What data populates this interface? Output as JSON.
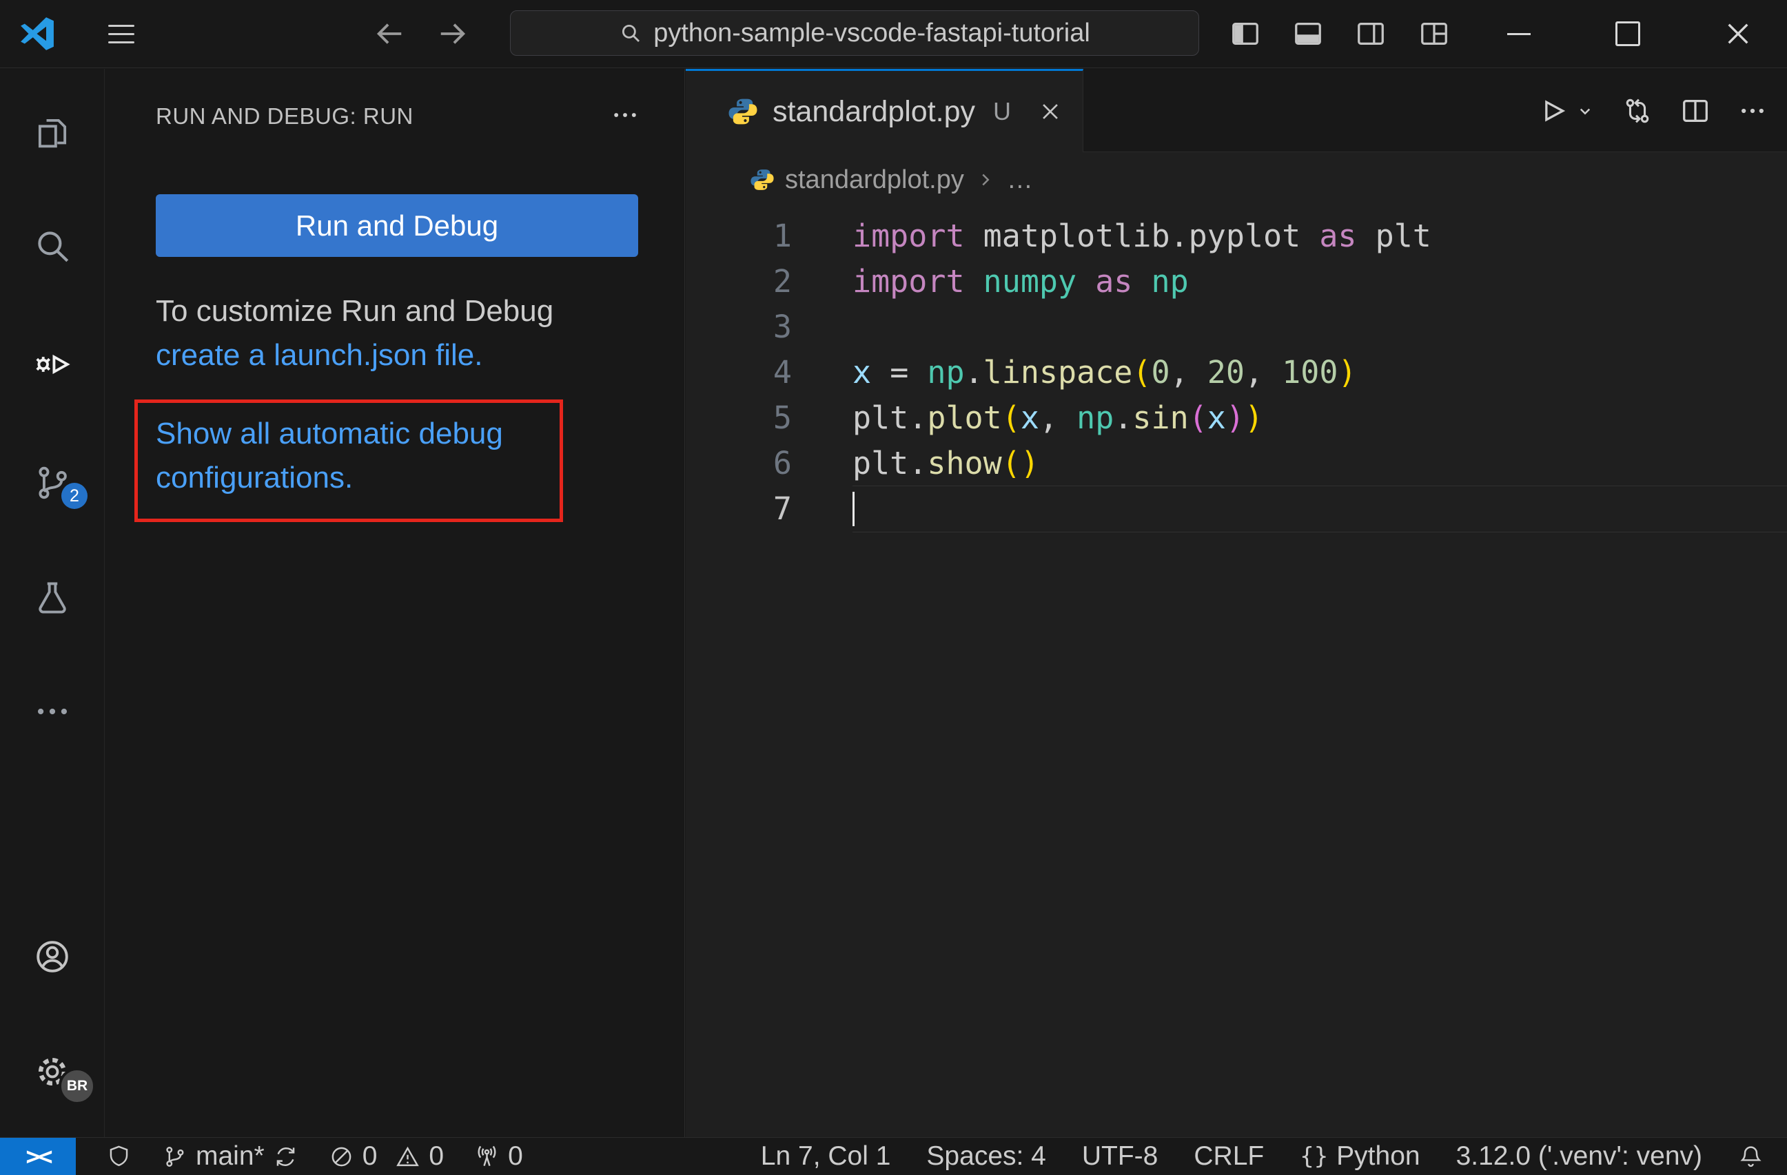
{
  "titlebar": {
    "search_value": "python-sample-vscode-fastapi-tutorial"
  },
  "activity_bar": {
    "scm_badge": "2",
    "profile_badge": "BR"
  },
  "sidebar": {
    "header": "RUN AND DEBUG: RUN",
    "run_button_label": "Run and Debug",
    "customize_text": "To customize Run and Debug",
    "launch_json_link": "create a launch.json file.",
    "auto_configs_link": "Show all automatic debug configurations."
  },
  "editor": {
    "tab": {
      "filename": "standardplot.py",
      "git_status": "U"
    },
    "breadcrumb": {
      "file": "standardplot.py",
      "more": "…"
    },
    "active_line": 7,
    "code_lines": [
      [
        [
          "kw",
          "import "
        ],
        [
          "def",
          "matplotlib.pyplot "
        ],
        [
          "kw",
          "as "
        ],
        [
          "def",
          "plt"
        ]
      ],
      [
        [
          "kw",
          "import "
        ],
        [
          "mod",
          "numpy "
        ],
        [
          "kw",
          "as "
        ],
        [
          "mod",
          "np"
        ]
      ],
      [],
      [
        [
          "var",
          "x "
        ],
        [
          "def",
          "= "
        ],
        [
          "mod",
          "np"
        ],
        [
          "def",
          "."
        ],
        [
          "fn",
          "linspace"
        ],
        [
          "b1",
          "("
        ],
        [
          "num",
          "0"
        ],
        [
          "def",
          ", "
        ],
        [
          "num",
          "20"
        ],
        [
          "def",
          ", "
        ],
        [
          "num",
          "100"
        ],
        [
          "b1",
          ")"
        ]
      ],
      [
        [
          "def",
          "plt"
        ],
        [
          "def",
          "."
        ],
        [
          "fn",
          "plot"
        ],
        [
          "b1",
          "("
        ],
        [
          "var",
          "x"
        ],
        [
          "def",
          ", "
        ],
        [
          "mod",
          "np"
        ],
        [
          "def",
          "."
        ],
        [
          "fn",
          "sin"
        ],
        [
          "b2",
          "("
        ],
        [
          "var",
          "x"
        ],
        [
          "b2",
          ")"
        ],
        [
          "b1",
          ")"
        ]
      ],
      [
        [
          "def",
          "plt"
        ],
        [
          "def",
          "."
        ],
        [
          "fn",
          "show"
        ],
        [
          "b1",
          "("
        ],
        [
          "b1",
          ")"
        ]
      ],
      []
    ]
  },
  "statusbar": {
    "remote_glyph": "><",
    "branch": "main*",
    "errors": "0",
    "warnings": "0",
    "ports": "0",
    "cursor_position": "Ln 7, Col 1",
    "indentation": "Spaces: 4",
    "encoding": "UTF-8",
    "eol": "CRLF",
    "language_glyph": "{}",
    "language": "Python",
    "interpreter": "3.12.0 ('.venv': venv)"
  },
  "colors": {
    "accent_button_blue": "#3576cd",
    "link_blue": "#4aa0f8",
    "annotation_red": "#e5251c",
    "remote_blue": "#0c72ce",
    "badge_blue": "#2472c8",
    "tab_active_border": "#0078d4"
  }
}
